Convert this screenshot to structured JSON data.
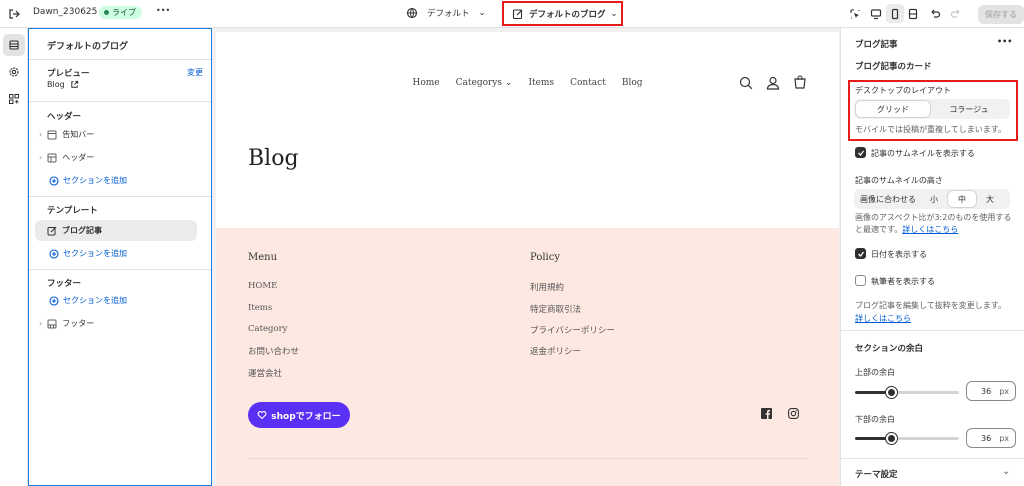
{
  "topbar": {
    "store_name": "Dawn_230625",
    "live_badge": "ライブ",
    "more": "•••",
    "theme_select": "デフォルト",
    "template_select": "デフォルトのブログ",
    "save_label": "保存する"
  },
  "sidebar": {
    "title": "デフォルトのブログ",
    "preview_label": "プレビュー",
    "preview_value": "Blog",
    "change_link": "変更",
    "header_group": "ヘッダー",
    "header_items": [
      "告知バー",
      "ヘッダー"
    ],
    "add_section": "セクションを追加",
    "template_group": "テンプレート",
    "template_item": "ブログ記事",
    "footer_group": "フッター",
    "footer_item": "フッター"
  },
  "preview": {
    "nav": [
      "Home",
      "Categorys",
      "Items",
      "Contact",
      "Blog"
    ],
    "page_title": "Blog",
    "footer": {
      "menu_heading": "Menu",
      "menu_items": [
        "HOME",
        "Items",
        "Category",
        "お問い合わせ",
        "運営会社"
      ],
      "policy_heading": "Policy",
      "policy_items": [
        "利用規約",
        "特定商取引法",
        "プライバシーポリシー",
        "返金ポリシー"
      ],
      "follow_button": "shopでフォロー"
    },
    "colors": {
      "footer_bg": "#fde8e2",
      "follow_button": "#5a31f4"
    }
  },
  "settings": {
    "panel_title": "ブログ記事",
    "card_heading": "ブログ記事のカード",
    "layout_label": "デスクトップのレイアウト",
    "layout_options": [
      "グリッド",
      "コラージュ"
    ],
    "layout_selected": "グリッド",
    "layout_help": "モバイルでは投稿が重複してしまいます。",
    "show_thumbnail": "記事のサムネイルを表示する",
    "show_thumbnail_checked": true,
    "thumb_height_label": "記事のサムネイルの高さ",
    "thumb_height_options": [
      "画像に合わせる",
      "小",
      "中",
      "大"
    ],
    "thumb_height_selected": "中",
    "thumb_help": "画像のアスペクト比が3:2のものを使用すると最適です。",
    "thumb_help_link": "詳しくはこちら",
    "show_date": "日付を表示する",
    "show_date_checked": true,
    "show_author": "執筆者を表示する",
    "show_author_checked": false,
    "excerpt_help": "ブログ記事を編集して抜粋を変更します。",
    "excerpt_link": "詳しくはこちら",
    "padding_heading": "セクションの余白",
    "top_padding_label": "上部の余白",
    "top_padding_value": "36",
    "bottom_padding_label": "下部の余白",
    "bottom_padding_value": "36",
    "unit": "px",
    "theme_settings": "テーマ設定"
  }
}
